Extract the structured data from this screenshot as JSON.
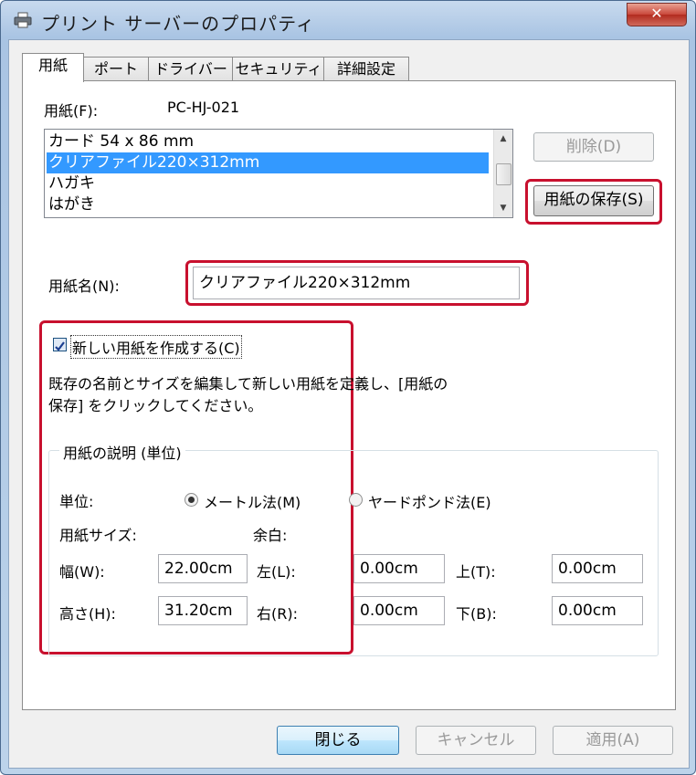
{
  "window": {
    "title": "プリント サーバーのプロパティ",
    "close_label": "✕"
  },
  "tabs": [
    {
      "label": "用紙",
      "active": true
    },
    {
      "label": "ポート",
      "active": false
    },
    {
      "label": "ドライバー",
      "active": false
    },
    {
      "label": "セキュリティ",
      "active": false
    },
    {
      "label": "詳細設定",
      "active": false
    }
  ],
  "form_list": {
    "label": "用紙(F):",
    "printer_name": "PC-HJ-021",
    "items": [
      {
        "text": "カード 54 x 86 mm",
        "selected": false
      },
      {
        "text": "クリアファイル220×312mm",
        "selected": true
      },
      {
        "text": "ハガキ",
        "selected": false
      },
      {
        "text": "はがき",
        "selected": false
      }
    ]
  },
  "buttons": {
    "delete": "削除(D)",
    "save_form": "用紙の保存(S)",
    "close": "閉じる",
    "cancel": "キャンセル",
    "apply": "適用(A)"
  },
  "form_name": {
    "label": "用紙名(N):",
    "value": "クリアファイル220×312mm"
  },
  "create_new": {
    "label": "新しい用紙を作成する(C)",
    "checked": true,
    "help_line1": "既存の名前とサイズを編集して新しい用紙を定義し、[用紙の",
    "help_line2": "保存] をクリックしてください。"
  },
  "description": {
    "group_title": "用紙の説明 (単位)",
    "unit_label": "単位:",
    "metric_label": "メートル法(M)",
    "metric_selected": true,
    "imperial_label": "ヤードポンド法(E)",
    "paper_size_label": "用紙サイズ:",
    "margins_label": "余白:",
    "width_label": "幅(W):",
    "width_value": "22.00cm",
    "height_label": "高さ(H):",
    "height_value": "31.20cm",
    "left_label": "左(L):",
    "left_value": "0.00cm",
    "right_label": "右(R):",
    "right_value": "0.00cm",
    "top_label": "上(T):",
    "top_value": "0.00cm",
    "bottom_label": "下(B):",
    "bottom_value": "0.00cm"
  },
  "icons": {
    "title": "printer-icon",
    "scroll_up": "arrow-up-icon",
    "scroll_down": "arrow-down-icon"
  },
  "colors": {
    "highlight": "#c8102e",
    "selection": "#3399ff"
  }
}
